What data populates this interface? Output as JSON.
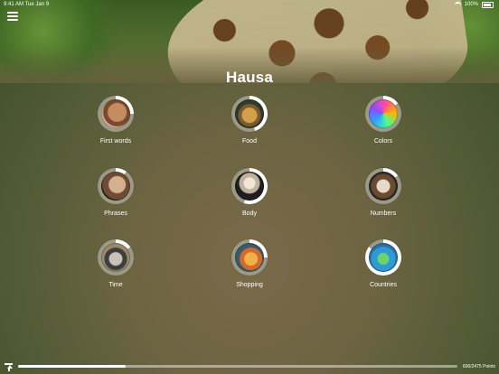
{
  "status_bar": {
    "time": "9:41 AM",
    "date": "Tue Jan 9",
    "battery": "100%"
  },
  "icons": {
    "menu": "hamburger-menu-icon",
    "wifi": "wifi-icon",
    "battery": "battery-icon",
    "scroll_top": "scroll-to-top-icon"
  },
  "page": {
    "title": "Hausa"
  },
  "categories": [
    {
      "label": "First words",
      "progress": 0.25
    },
    {
      "label": "Food",
      "progress": 0.45
    },
    {
      "label": "Colors",
      "progress": 0.15
    },
    {
      "label": "Phrases",
      "progress": 0.1
    },
    {
      "label": "Body",
      "progress": 0.55
    },
    {
      "label": "Numbers",
      "progress": 0.15
    },
    {
      "label": "Time",
      "progress": 0.15
    },
    {
      "label": "Shopping",
      "progress": 0.25
    },
    {
      "label": "Countries",
      "progress": 0.85
    }
  ],
  "footer": {
    "progress_fraction": 0.244,
    "points_text": "606/2475 Points"
  },
  "colors": {
    "ring_fill": "#ffffff",
    "ring_track": "#9b9a86"
  }
}
